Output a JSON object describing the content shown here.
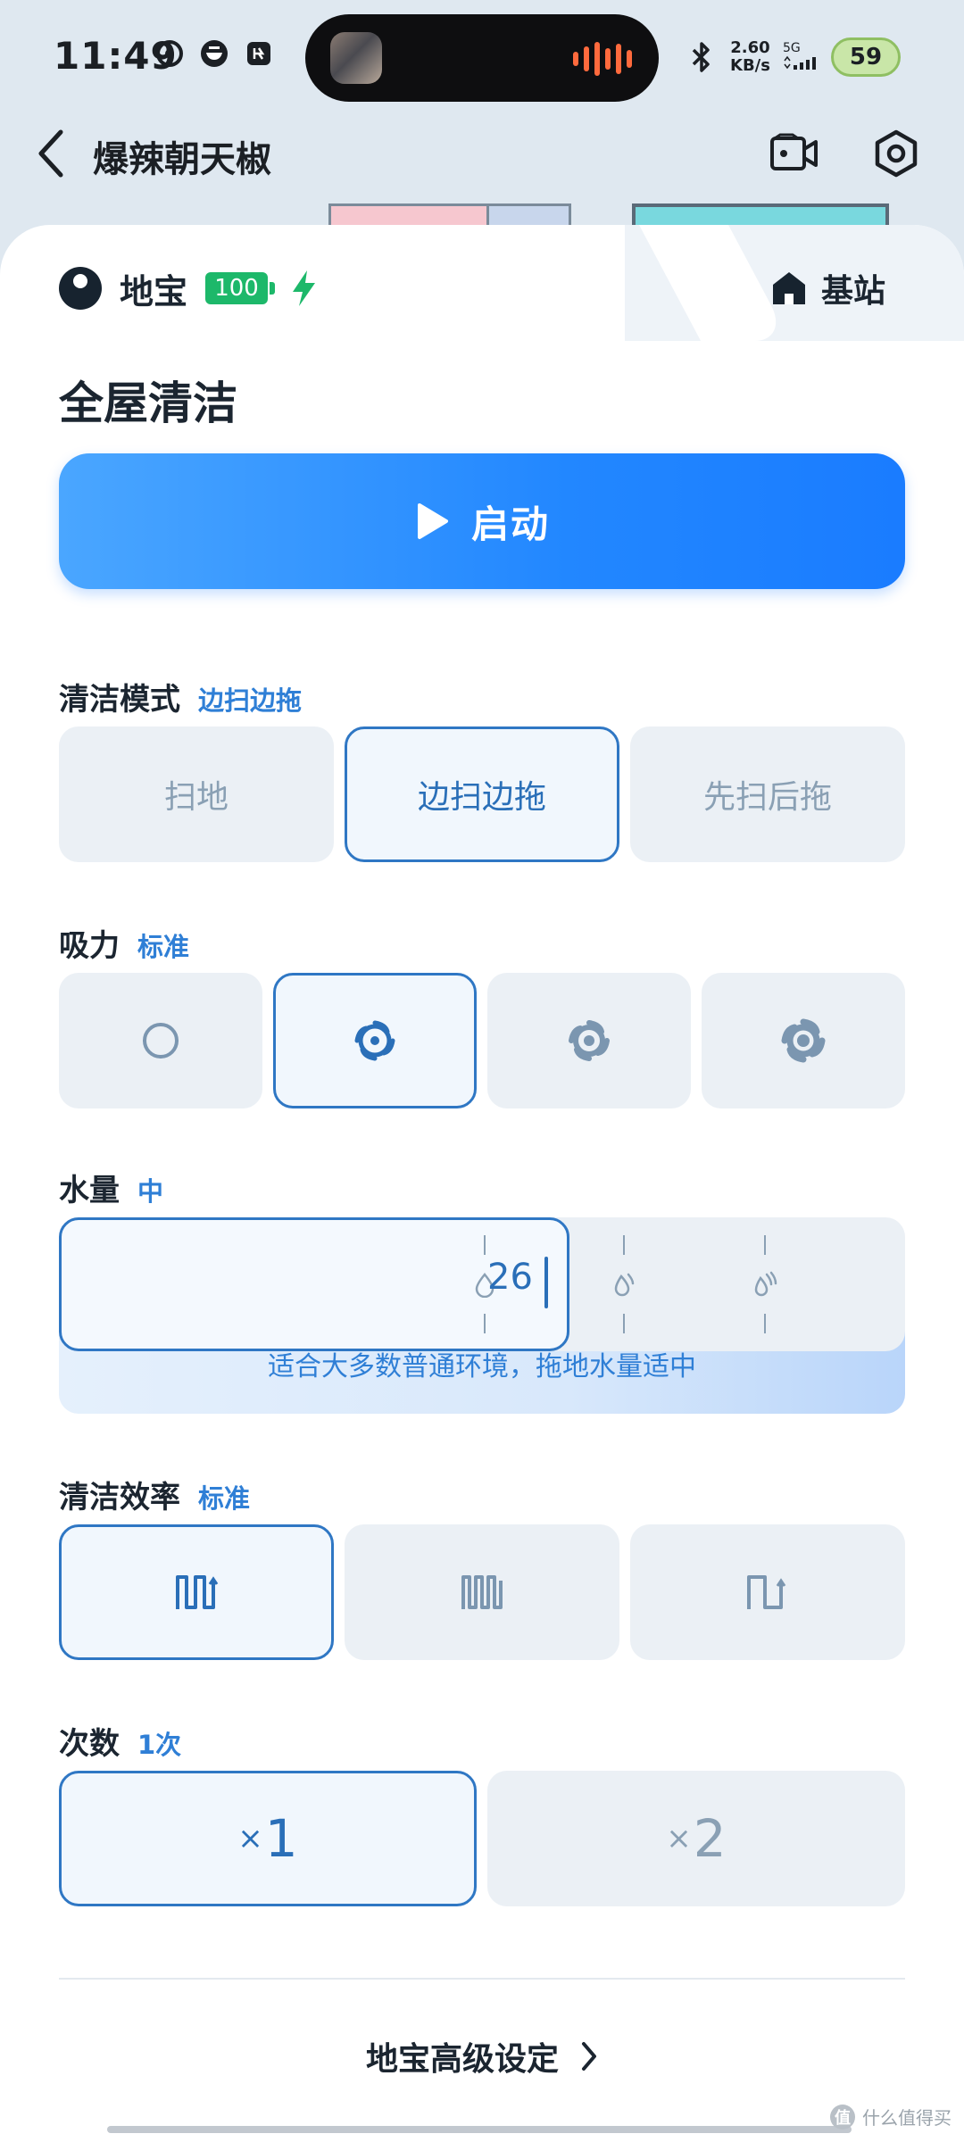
{
  "status_bar": {
    "time": "11:49",
    "speed_value": "2.60",
    "speed_unit": "KB/s",
    "network": "5G",
    "battery": "59"
  },
  "header": {
    "title": "爆辣朝天椒",
    "camera_icon": "video-camera-icon",
    "settings_icon": "settings-hexagon-icon"
  },
  "robot": {
    "name": "地宝",
    "battery": "100",
    "station_label": "基站"
  },
  "section_title": "全屋清洁",
  "start_label": "启动",
  "clean_mode": {
    "label": "清洁模式",
    "value": "边扫边拖",
    "options": [
      "扫地",
      "边扫边拖",
      "先扫后拖"
    ],
    "selected_index": 1
  },
  "suction": {
    "label": "吸力",
    "value": "标准",
    "levels": 4,
    "selected_index": 1
  },
  "water": {
    "label": "水量",
    "value": "中",
    "level": 26,
    "hint": "适合大多数普通环境，拖地水量适中"
  },
  "efficiency": {
    "label": "清洁效率",
    "value": "标准",
    "selected_index": 0
  },
  "passes": {
    "label": "次数",
    "value": "1次",
    "options": [
      "1",
      "2"
    ],
    "prefix": "×",
    "selected_index": 0
  },
  "advanced_label": "地宝高级设定",
  "watermark": "什么值得买",
  "colors": {
    "accent": "#2f77c4",
    "start_gradient_start": "#4aa6ff",
    "start_gradient_end": "#1a7cff",
    "battery_green": "#1db86a"
  }
}
